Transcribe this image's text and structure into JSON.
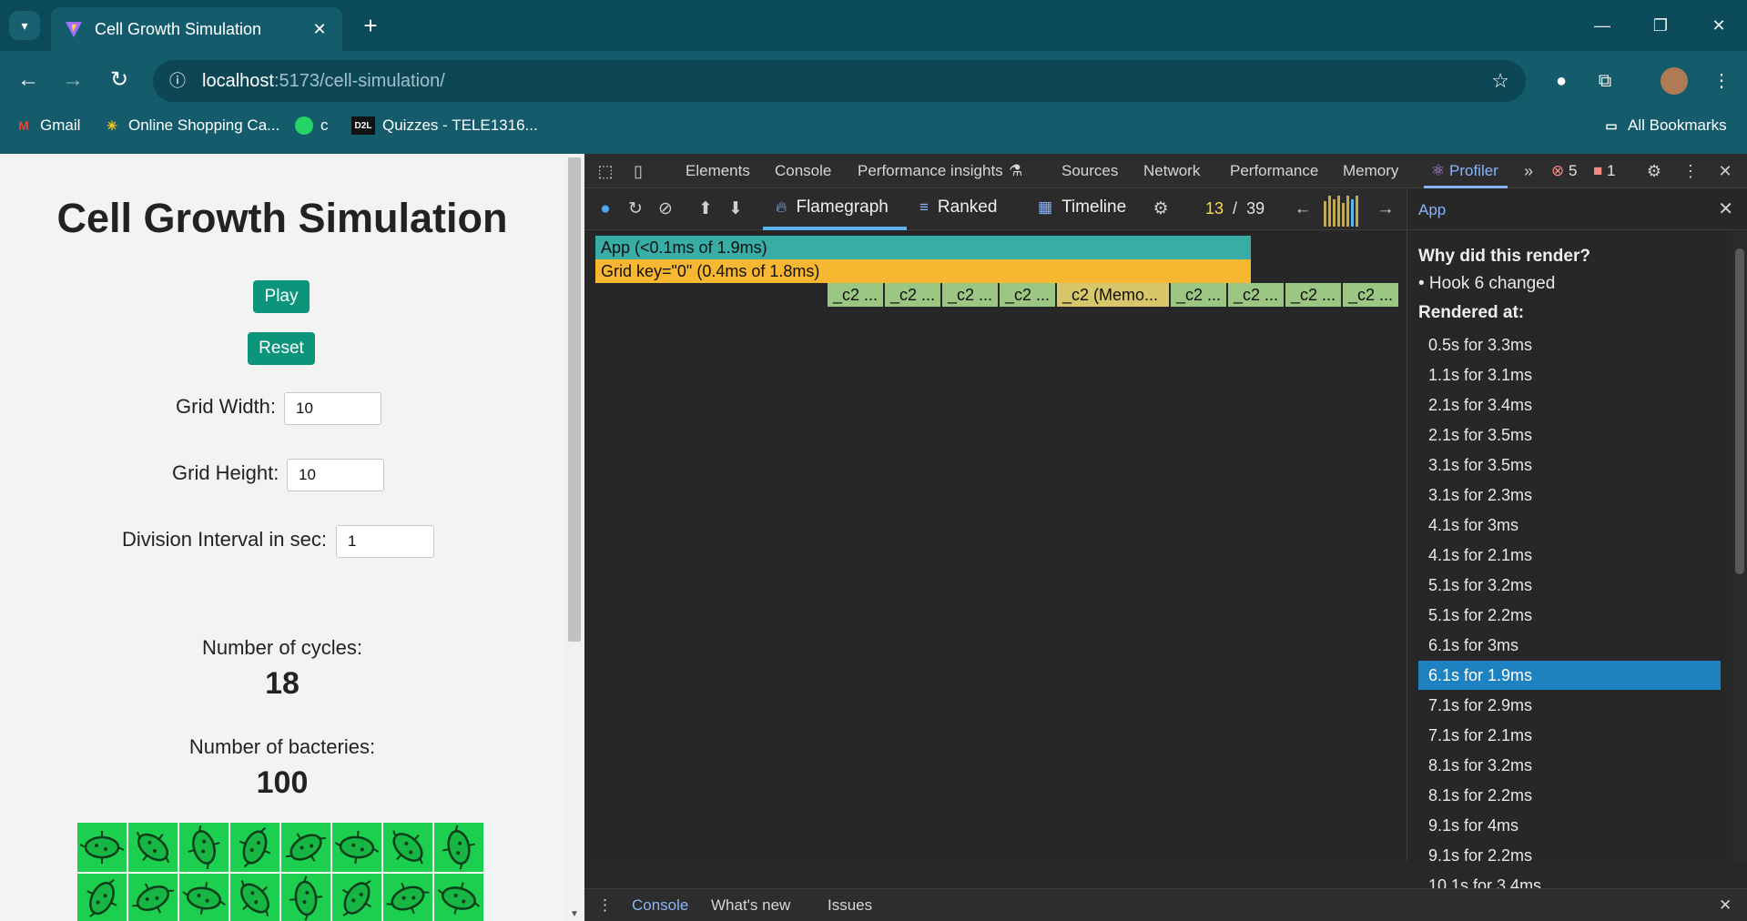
{
  "browser": {
    "tab_title": "Cell Growth Simulation",
    "url_host": "localhost",
    "url_rest": ":5173/cell-simulation/",
    "bookmarks": [
      {
        "label": "Gmail",
        "icon": "gmail-icon"
      },
      {
        "label": "Online Shopping Ca...",
        "icon": "walmart-icon"
      },
      {
        "label": "c",
        "icon": "whatsapp-icon"
      },
      {
        "label": "Quizzes - TELE1316...",
        "icon": "d2l-icon"
      }
    ],
    "all_bookmarks": "All Bookmarks",
    "colors": {
      "chrome": "#145c6c",
      "tabstrip": "#0b4a5a"
    }
  },
  "page": {
    "title": "Cell Growth Simulation",
    "play_label": "Play",
    "reset_label": "Reset",
    "grid_width_label": "Grid Width:",
    "grid_width_value": "10",
    "grid_height_label": "Grid Height:",
    "grid_height_value": "10",
    "interval_label": "Division Interval in sec:",
    "interval_value": "1",
    "cycles_label": "Number of cycles:",
    "cycles_value": "18",
    "bacteries_label": "Number of bacteries:",
    "bacteries_value": "100",
    "accent": "#0d957c",
    "cell_color": "#1ccf4e"
  },
  "devtools": {
    "tabs": [
      "Elements",
      "Console",
      "Performance insights",
      "Sources",
      "Network",
      "Performance",
      "Memory",
      "Profiler"
    ],
    "active_tab": "Profiler",
    "error_count": "5",
    "issue_count": "1",
    "profiler": {
      "views": [
        "Flamegraph",
        "Ranked",
        "Timeline"
      ],
      "active_view": "Flamegraph",
      "commit_current": "13",
      "commit_sep": "/",
      "commit_total": "39",
      "flame": {
        "app": "App (<0.1ms of 1.9ms)",
        "grid": "Grid key=\"0\" (0.4ms of 1.8ms)",
        "children": [
          "_c2 ...",
          "_c2 ...",
          "_c2 ...",
          "_c2 ...",
          "_c2 (Memo...",
          "_c2 ...",
          "_c2 ...",
          "_c2 ...",
          "_c2 ..."
        ]
      },
      "side": {
        "component": "App",
        "why_title": "Why did this render?",
        "why_reason": "• Hook 6 changed",
        "rendered_at_title": "Rendered at:",
        "renders": [
          "0.5s for 3.3ms",
          "1.1s for 3.1ms",
          "2.1s for 3.4ms",
          "2.1s for 3.5ms",
          "3.1s for 3.5ms",
          "3.1s for 2.3ms",
          "4.1s for 3ms",
          "4.1s for 2.1ms",
          "5.1s for 3.2ms",
          "5.1s for 2.2ms",
          "6.1s for 3ms",
          "6.1s for 1.9ms",
          "7.1s for 2.9ms",
          "7.1s for 2.1ms",
          "8.1s for 3.2ms",
          "8.1s for 2.2ms",
          "9.1s for 4ms",
          "9.1s for 2.2ms",
          "10.1s for 3.4ms"
        ],
        "selected_index": 11
      }
    },
    "drawer_tabs": [
      "Console",
      "What's new",
      "Issues"
    ],
    "drawer_active": "Console"
  }
}
